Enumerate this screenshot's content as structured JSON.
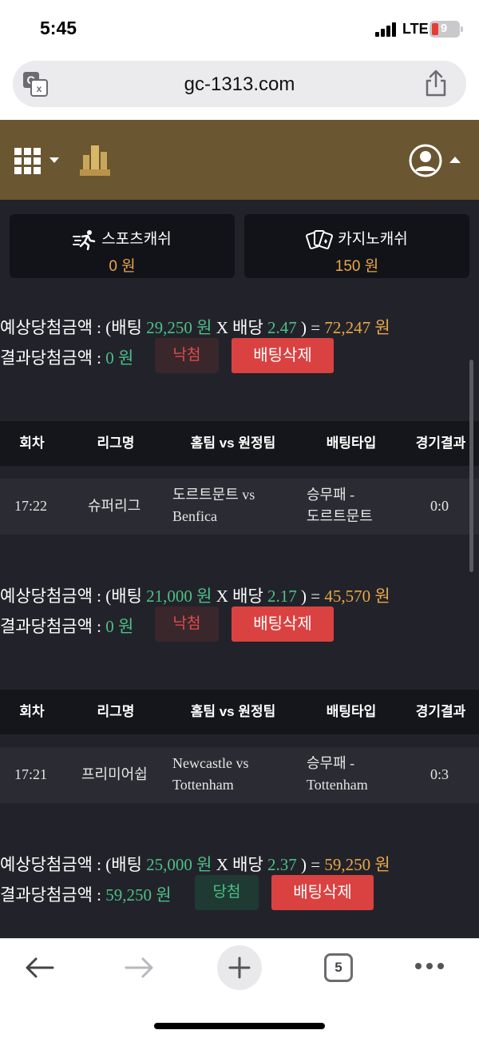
{
  "status_bar": {
    "time": "5:45",
    "network": "LTE",
    "battery": "9"
  },
  "browser": {
    "url": "gc-1313.com",
    "tab_count": "5"
  },
  "balances": [
    {
      "label": "스포츠캐쉬",
      "amount": "0 원"
    },
    {
      "label": "카지노캐쉬",
      "amount": "150 원"
    }
  ],
  "labels": {
    "expected": "예상당첨금액 : (배팅",
    "times": "X 배당",
    "equals": ") =",
    "result": "결과당첨금액 :",
    "delete": "배팅삭제",
    "won_unit": "원"
  },
  "table_headers": [
    "회차",
    "리그명",
    "홈팀 vs 원정팀",
    "배팅타입",
    "경기결과"
  ],
  "bets": [
    {
      "stake": "29,250 원",
      "odds": "2.47",
      "expected": "72,247 원",
      "result_amount": "0 원",
      "status": "낙첨",
      "row": {
        "round": "17:22",
        "league": "슈퍼리그",
        "teams_line1": "도르트문트 vs",
        "teams_line2": "Benfica",
        "type_line1": "승무패 -",
        "type_line2": "도르트문트",
        "score": "0:0"
      }
    },
    {
      "stake": "21,000 원",
      "odds": "2.17",
      "expected": "45,570 원",
      "result_amount": "0 원",
      "status": "낙첨",
      "row": {
        "round": "17:21",
        "league": "프리미어쉽",
        "teams_line1": "Newcastle vs",
        "teams_line2": "Tottenham",
        "type_line1": "승무패 -",
        "type_line2": "Tottenham",
        "score": "0:3"
      }
    },
    {
      "stake": "25,000 원",
      "odds": "2.37",
      "expected": "59,250 원",
      "result_amount": "59,250 원",
      "status": "당첨"
    }
  ],
  "colors": {
    "header": "#6a5631",
    "background": "#22232a",
    "green": "#4dbf86",
    "orange": "#e9a74a",
    "delete": "#d94241"
  }
}
